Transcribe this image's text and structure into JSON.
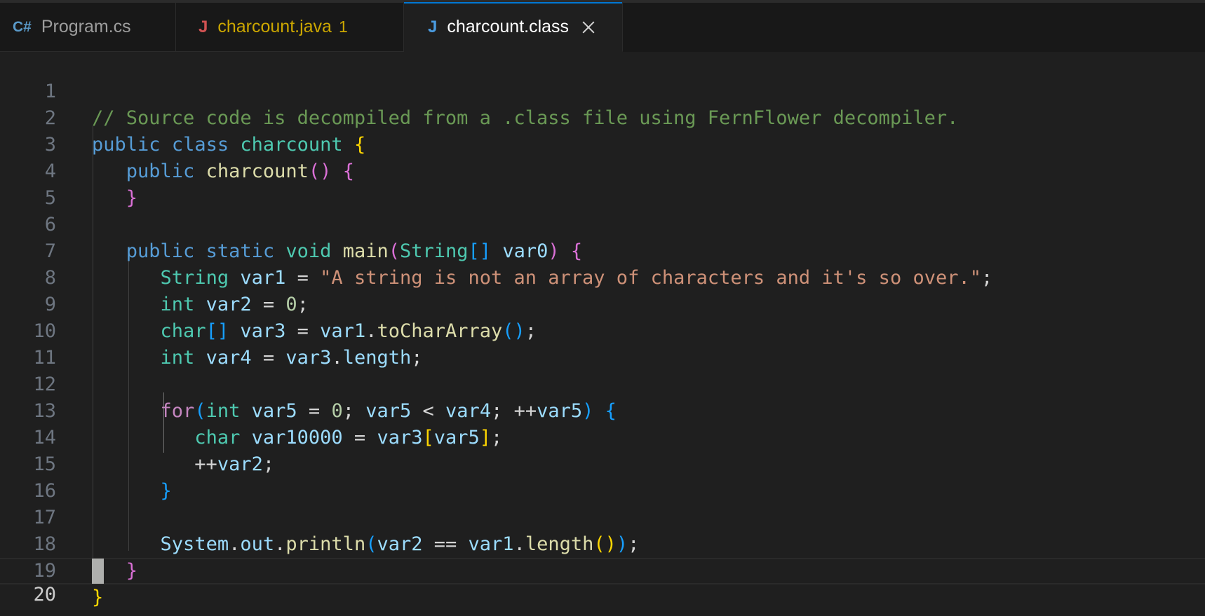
{
  "tabs": [
    {
      "icon": "C#",
      "label": "Program.cs",
      "badge": ""
    },
    {
      "icon": "J",
      "label": "charcount.java",
      "badge": "1"
    },
    {
      "icon": "J",
      "label": "charcount.class",
      "badge": ""
    }
  ],
  "line_numbers": [
    "1",
    "2",
    "3",
    "4",
    "5",
    "6",
    "7",
    "8",
    "9",
    "10",
    "11",
    "12",
    "13",
    "14",
    "15",
    "16",
    "17",
    "18",
    "19",
    "20"
  ],
  "code": {
    "l1_comment": "// Source code is decompiled from a .class file using FernFlower decompiler.",
    "l2_public": "public",
    "l2_class": "class",
    "l2_name": "charcount",
    "l3_public": "public",
    "l3_name": "charcount",
    "l6_public": "public",
    "l6_static": "static",
    "l6_void": "void",
    "l6_main": "main",
    "l6_type": "String",
    "l6_param": "var0",
    "l7_type": "String",
    "l7_var": "var1",
    "l7_str": "\"A string is not an array of characters and it's so over.\"",
    "l8_type": "int",
    "l8_var": "var2",
    "l8_num": "0",
    "l9_type": "char",
    "l9_var": "var3",
    "l9_obj": "var1",
    "l9_fn": "toCharArray",
    "l10_type": "int",
    "l10_var": "var4",
    "l10_obj": "var3",
    "l10_prop": "length",
    "l12_for": "for",
    "l12_type": "int",
    "l12_var": "var5",
    "l12_num": "0",
    "l12_cmp_a": "var5",
    "l12_cmp_b": "var4",
    "l12_inc": "var5",
    "l13_type": "char",
    "l13_var": "var10000",
    "l13_obj": "var3",
    "l13_idx": "var5",
    "l14_var": "var2",
    "l17_obj": "System",
    "l17_field": "out",
    "l17_fn": "println",
    "l17_a": "var2",
    "l17_b": "var1",
    "l17_fn2": "length"
  }
}
